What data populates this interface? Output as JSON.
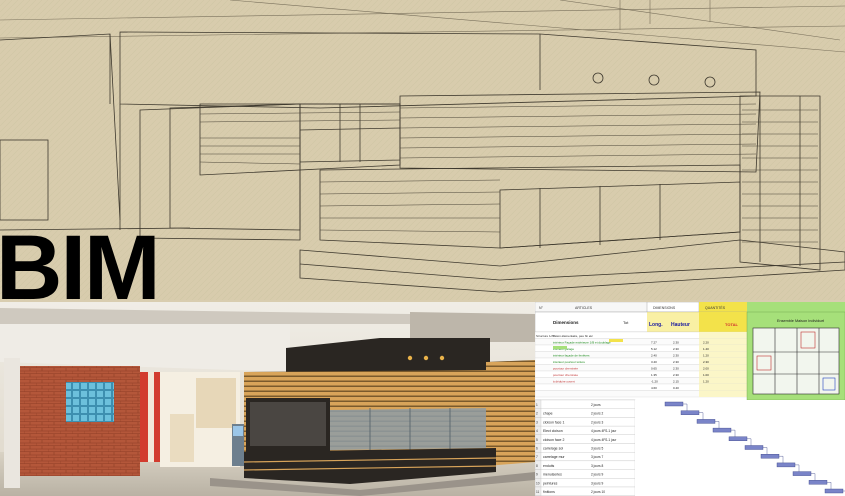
{
  "title": "BIM",
  "spreadsheet": {
    "header": {
      "row_num_label": "N°",
      "article_label": "ARTICLES",
      "dimensions_label": "DIMENSIONS",
      "quantities_label": "QUANTITÉS",
      "section_label": "Dimensions",
      "unit_label": "Tot",
      "long_label": "Long.",
      "haut_label": "Hauteur",
      "total_label": "TOTAL",
      "plan_title": "Ensemble Maison Individuel"
    },
    "rows": [
      {
        "ref": "Structure 1/A",
        "label": "Béton élémentaire, peu fin etc",
        "long": "",
        "haut": "",
        "qty": ""
      },
      {
        "ref": "",
        "label": "intérieur Façade extérieure 1/B et doublage",
        "long": "7.27",
        "haut": "2.30",
        "qty": "2.20"
      },
      {
        "ref": "",
        "label": "intérieur garage",
        "long": "5.12",
        "haut": "2.30",
        "qty": "1.40"
      },
      {
        "ref": "",
        "label": "intérieur façade de fenêtres",
        "long": "2.40",
        "haut": "2.30",
        "qty": "1.20"
      },
      {
        "ref": "",
        "label": "intérieur pourtour toiture",
        "long": "3.40",
        "haut": "2.30",
        "qty": "2.30"
      },
      {
        "ref": "",
        "label": "pourtour cheminée",
        "long": "0.65",
        "haut": "2.30",
        "qty": "2.00"
      },
      {
        "ref": "",
        "label": "pourtour cheminée",
        "long": "1.35",
        "haut": "2.30",
        "qty": "1.00"
      },
      {
        "ref": "",
        "label": "à déduire ouvert",
        "long": "-1.20",
        "haut": "2.15",
        "qty": "1.20"
      },
      {
        "ref": "",
        "label": "",
        "long": "4.60",
        "haut": "0.40",
        "qty": ""
      },
      {
        "ref": "",
        "label": "",
        "long": "",
        "haut": "",
        "qty": ""
      }
    ],
    "schedule": [
      {
        "num": "1",
        "task": "",
        "duration": "2 jours"
      },
      {
        "num": "2",
        "task": "chape",
        "duration": "2 jours 2"
      },
      {
        "num": "3",
        "task": "cloison face 1",
        "duration": "2 jours 3"
      },
      {
        "num": "4",
        "task": "Elect cloison",
        "duration": "4 jours 4FS-1 jour"
      },
      {
        "num": "5",
        "task": "cloison face 2",
        "duration": "4 jours 4FS-1 jour"
      },
      {
        "num": "6",
        "task": "carrelage sol",
        "duration": "3 jours 5"
      },
      {
        "num": "7",
        "task": "carrelage mur",
        "duration": "3 jours 7"
      },
      {
        "num": "8",
        "task": "enduits",
        "duration": "3 jours 8"
      },
      {
        "num": "9",
        "task": "menuiseries",
        "duration": "2 jours 9"
      },
      {
        "num": "10",
        "task": "peintures",
        "duration": "3 jours 9"
      },
      {
        "num": "11",
        "task": "finitions",
        "duration": "2 jours 10"
      }
    ]
  },
  "colors": {
    "sketch_bg": "#d8ccad",
    "sketch_line": "#4a4437",
    "brick": "#b4573a",
    "wood": "#d8a45a",
    "dark_band": "#2a2622",
    "sheet_yellow": "#f3e24a",
    "sheet_green": "#a6e07a",
    "gantt_bar": "#7a84c8"
  }
}
